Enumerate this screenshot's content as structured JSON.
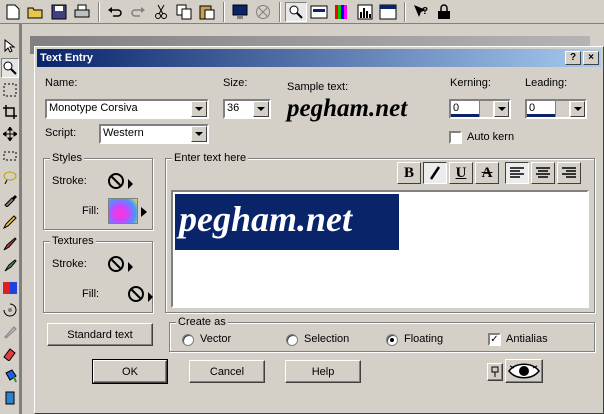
{
  "toolbar": {
    "icons": [
      "new-icon",
      "open-icon",
      "save-icon",
      "print-icon",
      "undo-icon",
      "redo-icon",
      "cut-icon",
      "copy-icon",
      "paste-icon",
      "monitor-icon",
      "web-icon",
      "zoom-icon",
      "toolbar-icon",
      "palette-icon",
      "histogram-icon",
      "window-icon",
      "help-icon",
      "lock-icon"
    ]
  },
  "dialog": {
    "title": "Text Entry",
    "name_label": "Name:",
    "font_name": "Monotype Corsiva",
    "size_label": "Size:",
    "font_size": "36",
    "sample_label": "Sample text:",
    "sample_text": "pegham.net",
    "kerning_label": "Kerning:",
    "kerning_value": "0",
    "leading_label": "Leading:",
    "leading_value": "0",
    "auto_kern_label": "Auto kern",
    "auto_kern_checked": false,
    "script_label": "Script:",
    "script_value": "Western",
    "styles": {
      "title": "Styles",
      "stroke_label": "Stroke:",
      "fill_label": "Fill:"
    },
    "textures": {
      "title": "Textures",
      "stroke_label": "Stroke:",
      "fill_label": "Fill:"
    },
    "enter_text_label": "Enter text here",
    "entered_text": "pegham.net",
    "format_buttons": [
      "B",
      "I",
      "U",
      "A"
    ],
    "standard_text_button": "Standard text",
    "create_as": {
      "title": "Create as",
      "options": [
        "Vector",
        "Selection",
        "Floating"
      ],
      "selected": "Floating",
      "antialias_label": "Antialias",
      "antialias_checked": true
    },
    "buttons": {
      "ok": "OK",
      "cancel": "Cancel",
      "help": "Help"
    }
  },
  "colors": {
    "title_bar_start": "#0a246a",
    "title_bar_end": "#a6caf0",
    "selection": "#0a246a",
    "face": "#d4d0c8"
  }
}
